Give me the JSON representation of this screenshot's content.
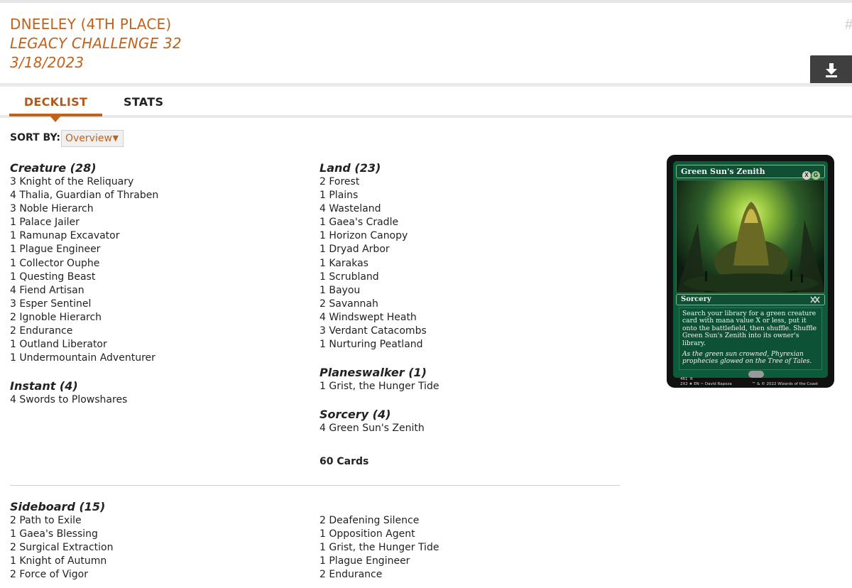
{
  "header": {
    "player": "DNEELEY (4TH PLACE)",
    "event": "LEGACY CHALLENGE 32",
    "date": "3/18/2023"
  },
  "icons": {
    "hash": "hash-icon",
    "download": "download-icon"
  },
  "tabs": [
    {
      "label": "DECKLIST",
      "active": true
    },
    {
      "label": "STATS",
      "active": false
    }
  ],
  "sort": {
    "label": "SORT BY:",
    "selected": "Overview"
  },
  "main_left": [
    {
      "title": "Creature (28)",
      "cards": [
        "3 Knight of the Reliquary",
        "4 Thalia, Guardian of Thraben",
        "3 Noble Hierarch",
        "1 Palace Jailer",
        "1 Ramunap Excavator",
        "1 Plague Engineer",
        "1 Collector Ouphe",
        "1 Questing Beast",
        "4 Fiend Artisan",
        "3 Esper Sentinel",
        "2 Ignoble Hierarch",
        "2 Endurance",
        "1 Outland Liberator",
        "1 Undermountain Adventurer"
      ]
    },
    {
      "title": "Instant (4)",
      "cards": [
        "4 Swords to Plowshares"
      ]
    }
  ],
  "main_right": [
    {
      "title": "Land (23)",
      "cards": [
        "2 Forest",
        "1 Plains",
        "4 Wasteland",
        "1 Gaea's Cradle",
        "1 Horizon Canopy",
        "1 Dryad Arbor",
        "1 Karakas",
        "1 Scrubland",
        "1 Bayou",
        "2 Savannah",
        "4 Windswept Heath",
        "3 Verdant Catacombs",
        "1 Nurturing Peatland"
      ]
    },
    {
      "title": "Planeswalker (1)",
      "cards": [
        "1 Grist, the Hunger Tide"
      ]
    },
    {
      "title": "Sorcery (4)",
      "cards": [
        "4 Green Sun's Zenith"
      ]
    }
  ],
  "total": "60 Cards",
  "sideboard": {
    "title": "Sideboard (15)",
    "left": [
      "2 Path to Exile",
      "1 Gaea's Blessing",
      "2 Surgical Extraction",
      "1 Knight of Autumn",
      "2 Force of Vigor"
    ],
    "right": [
      "2 Deafening Silence",
      "1 Opposition Agent",
      "1 Grist, the Hunger Tide",
      "1 Plague Engineer",
      "2 Endurance"
    ]
  },
  "card_preview": {
    "name": "Green Sun's Zenith",
    "type": "Sorcery",
    "rules": "Search your library for a green creature card with mana value X or less, put it onto the battlefield, then shuffle. Shuffle Green Sun's Zenith into its owner's library.",
    "flavor": "As the green sun crowned, Phyrexian prophecies glowed on the Tree of Tales.",
    "collector": "461",
    "rarity": "R",
    "set_line": "2X2 ★ EN",
    "artist": "David Rapoza",
    "copyright": "™ & © 2022 Wizards of the Coast",
    "mana": [
      "X",
      "G"
    ],
    "colors": {
      "frame": "#0e5b3b",
      "border": "#111111"
    }
  },
  "colors": {
    "accent": "#c0621c",
    "button": "#3f3f3f"
  }
}
